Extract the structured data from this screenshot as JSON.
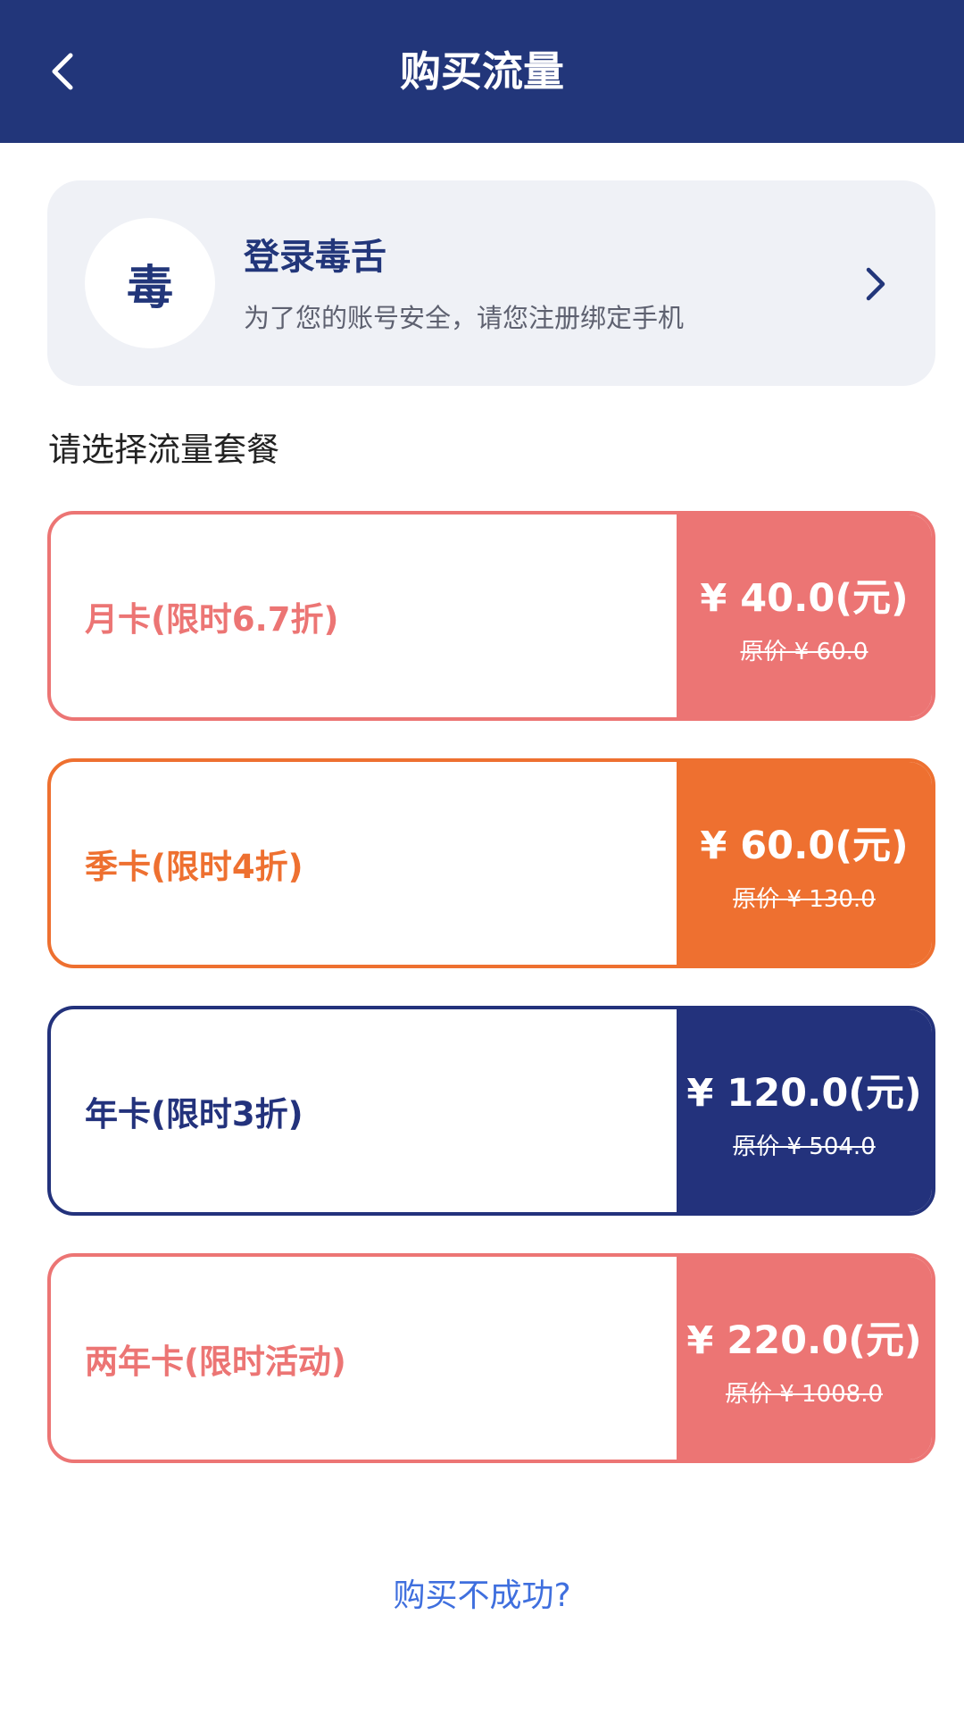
{
  "header": {
    "title": "购买流量",
    "bg_color": "#22367a"
  },
  "login_card": {
    "avatar_text": "毒",
    "title": "登录毒舌",
    "subtitle": "为了您的账号安全，请您注册绑定手机"
  },
  "section_label": "请选择流量套餐",
  "plans": [
    {
      "name": "月卡(限时6.7折)",
      "price": "¥ 40.0(元)",
      "original": "原价 ¥ 60.0",
      "color": "#ec7574"
    },
    {
      "name": "季卡(限时4折)",
      "price": "¥ 60.0(元)",
      "original": "原价 ¥ 130.0",
      "color": "#ee7030"
    },
    {
      "name": "年卡(限时3折)",
      "price": "¥ 120.0(元)",
      "original": "原价 ¥ 504.0",
      "color": "#23327c"
    },
    {
      "name": "两年卡(限时活动)",
      "price": "¥ 220.0(元)",
      "original": "原价 ¥ 1008.0",
      "color": "#ec7574"
    }
  ],
  "help_link": "购买不成功?"
}
